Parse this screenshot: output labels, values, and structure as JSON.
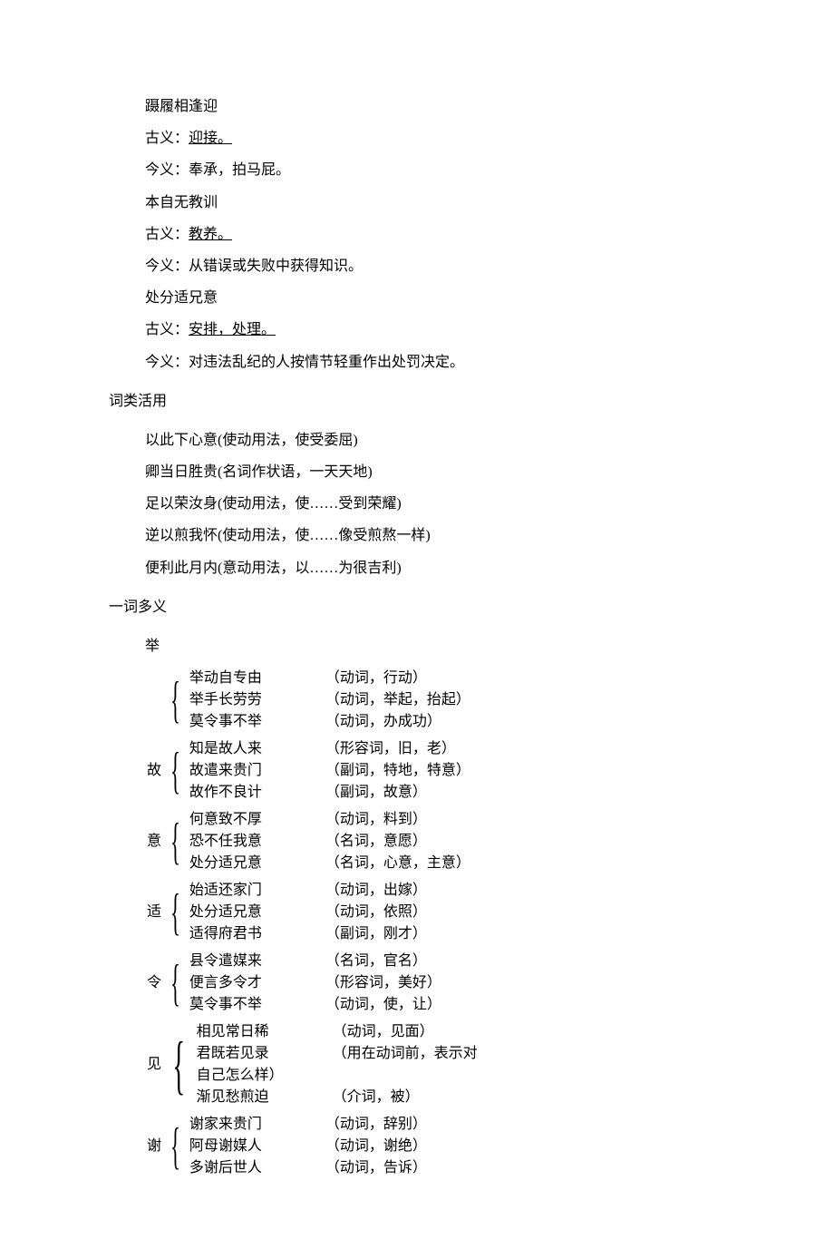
{
  "top": {
    "line1": "蹑履相逢迎",
    "gu_label": "古义：",
    "gu1": "迎接。",
    "jin_label": "今义：",
    "jin1": "奉承，拍马屁。",
    "line2": "本自无教训",
    "gu2": "教养。",
    "jin2": "从错误或失败中获得知识。",
    "line3": "处分适兄意",
    "gu3": "安排，处理。",
    "jin3": "对违法乱纪的人按情节轻重作出处罚决定。"
  },
  "s2_title": "词类活用",
  "s2": [
    "以此下心意(使动用法，使受委屈)",
    "卿当日胜贵(名词作状语，一天天地)",
    "足以荣汝身(使动用法，使……受到荣耀)",
    "逆以煎我怀(使动用法，使……像受煎熬一样)",
    "便利此月内(意动用法，以……为很吉利)"
  ],
  "s3_title": "一词多义",
  "s3_sub": "举",
  "poly": [
    {
      "key": "",
      "lines": [
        {
          "l": "举动自专由",
          "r": "（动词，行动）"
        },
        {
          "l": "举手长劳劳",
          "r": "（动词，举起，抬起）"
        },
        {
          "l": "莫令事不举",
          "r": "（动词，办成功）"
        }
      ]
    },
    {
      "key": "故",
      "lines": [
        {
          "l": "知是故人来",
          "r": "（形容词，旧，老）"
        },
        {
          "l": "故遣来贵门",
          "r": "（副词，特地，特意）"
        },
        {
          "l": "故作不良计",
          "r": "（副词，故意）"
        }
      ]
    },
    {
      "key": "意",
      "lines": [
        {
          "l": "何意致不厚",
          "r": "（动词，料到）"
        },
        {
          "l": "恐不任我意",
          "r": "（名词，意愿）"
        },
        {
          "l": "处分适兄意",
          "r": "（名词，心意，主意）"
        }
      ]
    },
    {
      "key": "适",
      "lines": [
        {
          "l": "始适还家门",
          "r": "（动词，出嫁）"
        },
        {
          "l": "处分适兄意",
          "r": "（动词，依照）"
        },
        {
          "l": "适得府君书",
          "r": "（副词，刚才）"
        }
      ]
    },
    {
      "key": "令",
      "lines": [
        {
          "l": "县令遣媒来",
          "r": "（名词，官名）"
        },
        {
          "l": "便言多令才",
          "r": "（形容词，美好）"
        },
        {
          "l": "莫令事不举",
          "r": "（动词，使，让）"
        }
      ]
    },
    {
      "key": "见",
      "lines": [
        {
          "l": "相见常日稀",
          "r": "（动词，见面）"
        },
        {
          "l": "君既若见录",
          "r": "（用在动词前，表示对"
        },
        {
          "l": "自己怎么样）",
          "r": ""
        },
        {
          "l": "渐见愁煎迫",
          "r": "（介词，被）"
        }
      ]
    },
    {
      "key": "谢",
      "lines": [
        {
          "l": "谢家来贵门",
          "r": "（动词，辞别）"
        },
        {
          "l": "阿母谢媒人",
          "r": "（动词，谢绝）"
        },
        {
          "l": "多谢后世人",
          "r": "（动词，告诉）"
        }
      ]
    }
  ]
}
